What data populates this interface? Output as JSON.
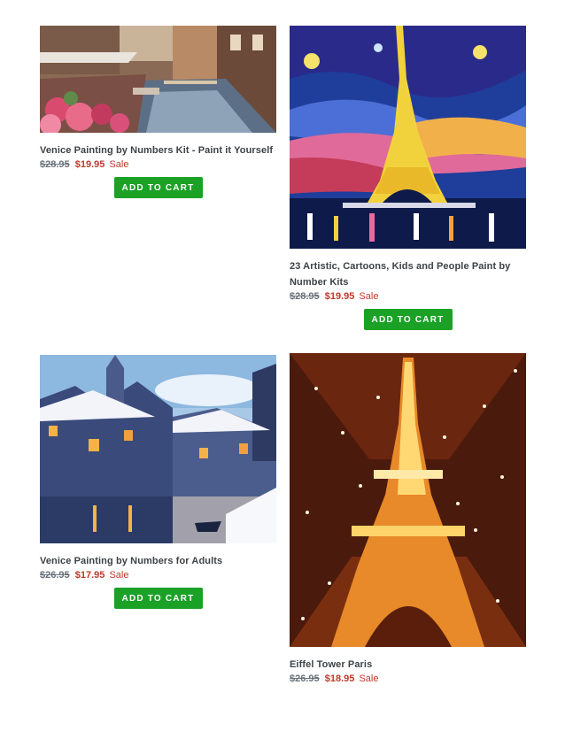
{
  "colors": {
    "add_to_cart_bg": "#1aa126",
    "sale_red": "#c0392b",
    "compare_gray": "#69727b"
  },
  "products": [
    {
      "title": "Venice Painting by Numbers Kit - Paint it Yourself",
      "compare_price": "$28.95",
      "price": "$19.95",
      "sale_label": "Sale",
      "button_label": "ADD TO CART",
      "image": "venice-canal-flowers-painting"
    },
    {
      "title": "23 Artistic, Cartoons, Kids and People Paint by Number Kits",
      "compare_price": "$28.95",
      "price": "$19.95",
      "sale_label": "Sale",
      "button_label": "ADD TO CART",
      "image": "eiffel-tower-starry-night-painting"
    },
    {
      "title": "Venice Painting by Numbers for Adults",
      "compare_price": "$26.95",
      "price": "$17.95",
      "sale_label": "Sale",
      "button_label": "ADD TO CART",
      "image": "snowy-canal-town-painting"
    },
    {
      "title": "Eiffel Tower Paris",
      "compare_price": "$26.95",
      "price": "$18.95",
      "sale_label": "Sale",
      "image": "eiffel-tower-lights-painting"
    }
  ]
}
